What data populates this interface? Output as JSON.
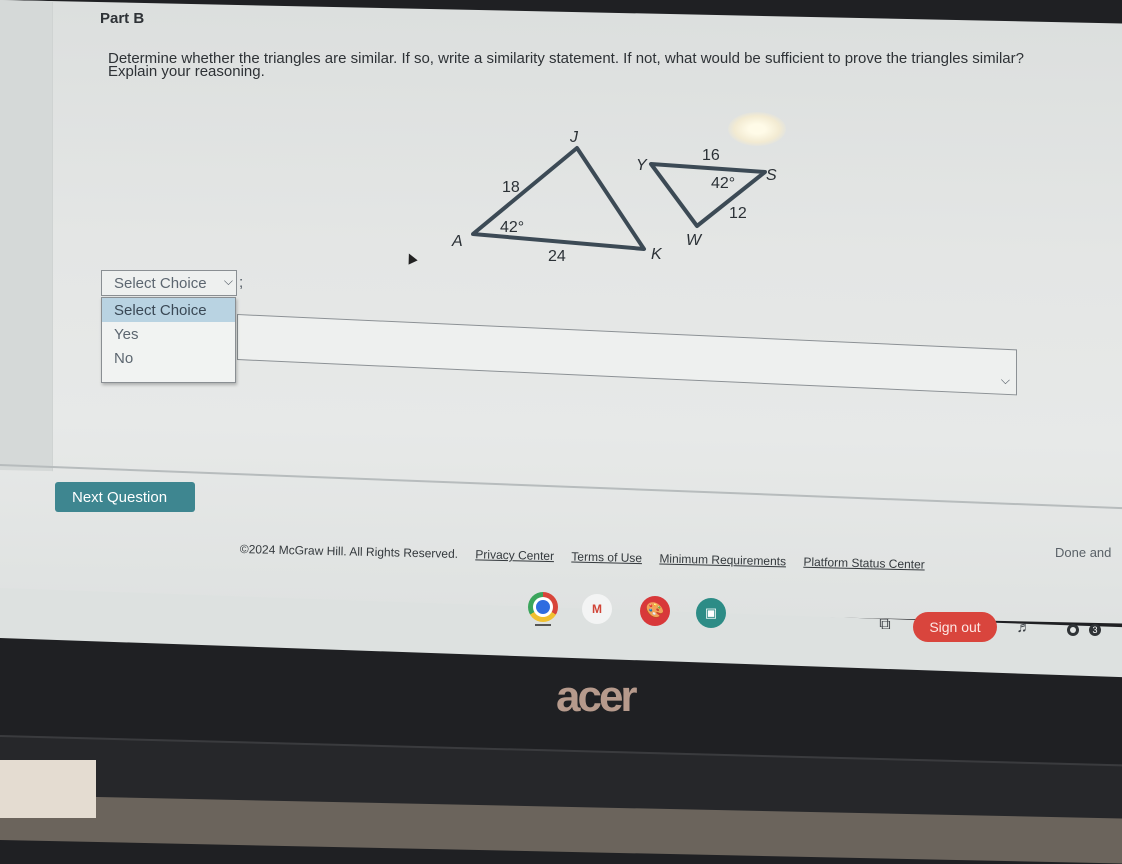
{
  "question": {
    "part_title": "Part B",
    "prompt_line1": "Determine whether the triangles are similar. If so, write a similarity statement. If not, what would be sufficient to prove the triangles similar?",
    "prompt_line2": "Explain your reasoning."
  },
  "figure": {
    "triangle_left": {
      "vertices": [
        "J",
        "A",
        "K"
      ],
      "side_AJ": "18",
      "side_AK": "24",
      "angle_A": "42°"
    },
    "triangle_right": {
      "vertices": [
        "Y",
        "S",
        "W"
      ],
      "side_YS": "16",
      "side_SW": "12",
      "angle_S": "42°"
    }
  },
  "answer": {
    "select_value": "Select Choice",
    "select_suffix": ";",
    "options": [
      "Select Choice",
      "Yes",
      "No"
    ],
    "selected_option_index": 0,
    "reason_value": ""
  },
  "actions": {
    "next_question_label": "Next Question",
    "done_label": "Done and"
  },
  "footer": {
    "copyright": "©2024 McGraw Hill. All Rights Reserved.",
    "links": [
      "Privacy Center",
      "Terms of Use",
      "Minimum Requirements",
      "Platform Status Center"
    ]
  },
  "shelf": {
    "apps": [
      "chrome-icon",
      "gmail-icon",
      "canvas-icon",
      "screencast-icon"
    ],
    "gmail_glyph": "M",
    "sign_out_label": "Sign out",
    "notification_count": "3"
  },
  "device": {
    "brand": "acer"
  },
  "colors": {
    "primary_button": "#3e8690",
    "sign_out": "#d9453d",
    "selected_option": "#b9d3e2"
  }
}
